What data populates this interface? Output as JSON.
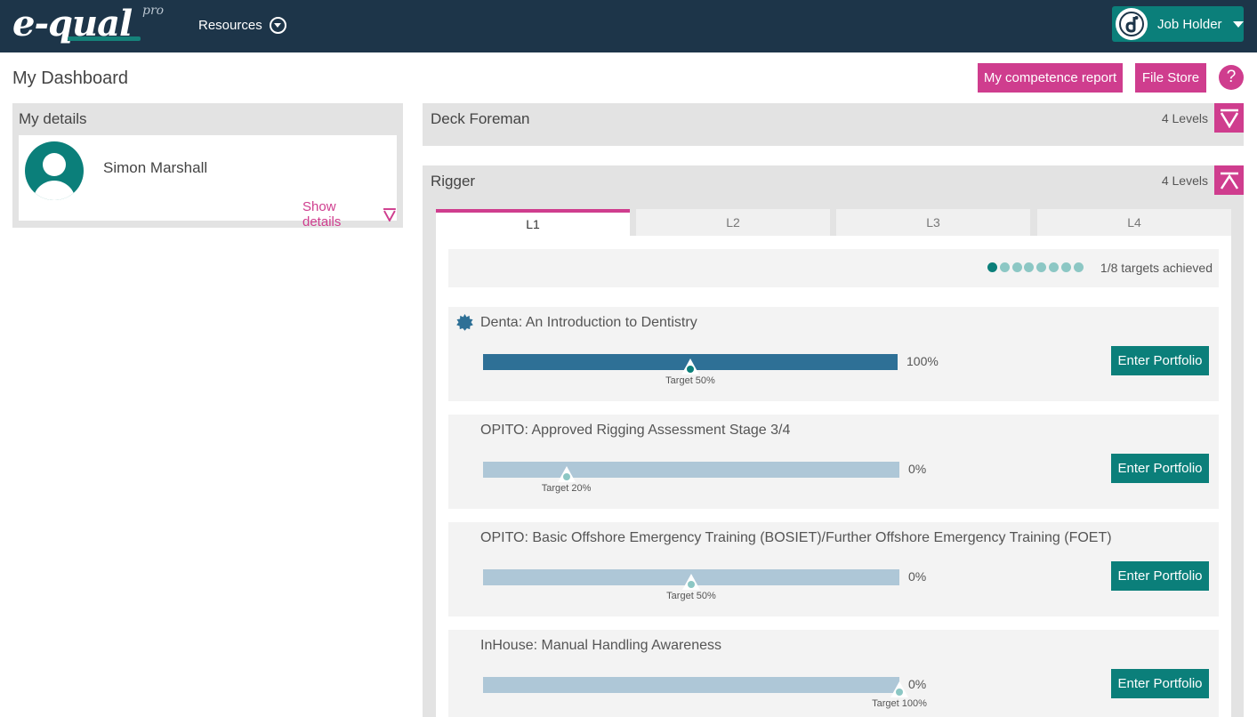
{
  "header": {
    "logo_text": "e-qual",
    "logo_pro": "pro",
    "resources_label": "Resources",
    "user_menu_label": "Job Holder"
  },
  "page": {
    "title": "My Dashboard",
    "competence_report_label": "My competence report",
    "file_store_label": "File Store",
    "help_label": "?"
  },
  "my_details": {
    "title": "My details",
    "name": "Simon Marshall",
    "show_details_label": "Show details"
  },
  "roles": [
    {
      "title": "Deck Foreman",
      "levels": "4 Levels",
      "expanded": false
    },
    {
      "title": "Rigger",
      "levels": "4 Levels",
      "expanded": true
    }
  ],
  "tabs": [
    "L1",
    "L2",
    "L3",
    "L4"
  ],
  "active_tab": "L1",
  "summary": {
    "targets_achieved": 1,
    "targets_total": 8,
    "text": "1/8 targets achieved"
  },
  "courses": [
    {
      "title": "Denta: An Introduction to Dentistry",
      "progress": 100,
      "progress_label": "100%",
      "target": 50,
      "target_label": "Target 50%",
      "achieved": true,
      "button": "Enter Portfolio"
    },
    {
      "title": "OPITO: Approved Rigging Assessment Stage 3/4",
      "progress": 0,
      "progress_label": "0%",
      "target": 20,
      "target_label": "Target 20%",
      "achieved": false,
      "button": "Enter Portfolio"
    },
    {
      "title": "OPITO: Basic Offshore Emergency Training (BOSIET)/Further Offshore Emergency Training (FOET)",
      "progress": 0,
      "progress_label": "0%",
      "target": 50,
      "target_label": "Target 50%",
      "achieved": false,
      "button": "Enter Portfolio"
    },
    {
      "title": "InHouse: Manual Handling Awareness",
      "progress": 0,
      "progress_label": "0%",
      "target": 100,
      "target_label": "Target 100%",
      "achieved": false,
      "button": "Enter Portfolio"
    }
  ],
  "colors": {
    "navbar": "#1d3549",
    "accent_pink": "#cf3d8e",
    "teal": "#0b7f7a",
    "bar_complete": "#2e7096",
    "bar_incomplete": "#aec7d7",
    "dot_pending": "#8cc7c4"
  }
}
